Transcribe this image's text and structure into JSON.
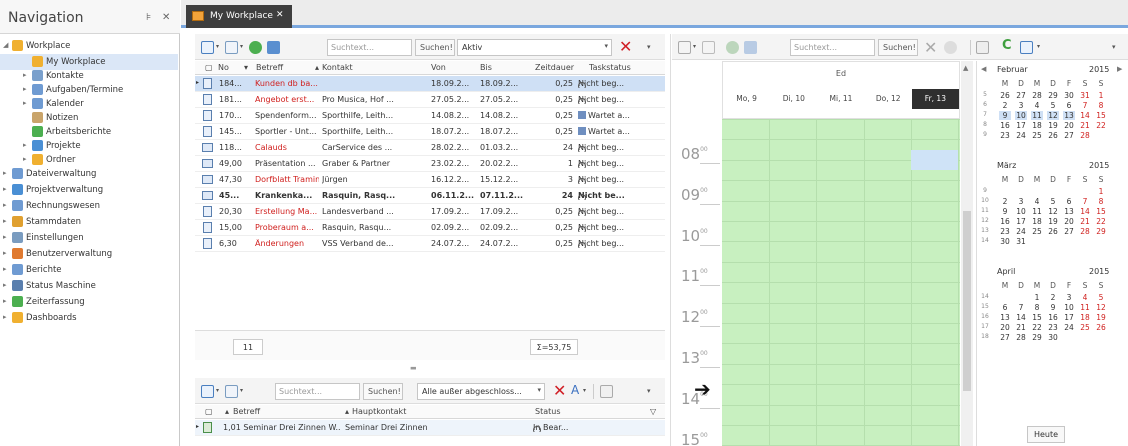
{
  "navigation": {
    "title": "Navigation",
    "pin_glyph": "⊧",
    "close_glyph": "✕",
    "items": [
      {
        "label": "Workplace",
        "level": 0,
        "expanded": true,
        "icon": "workplace-icon",
        "color": "#f0b030"
      },
      {
        "label": "My Workplace",
        "level": 1,
        "selected": true,
        "icon": "workplace-icon",
        "color": "#f0b030"
      },
      {
        "label": "Kontakte",
        "level": 1,
        "expanded": false,
        "icon": "contacts-icon",
        "color": "#7aa0cc"
      },
      {
        "label": "Aufgaben/Termine",
        "level": 1,
        "expanded": false,
        "icon": "tasks-icon",
        "color": "#6f9bd2"
      },
      {
        "label": "Kalender",
        "level": 1,
        "expanded": false,
        "icon": "calendar-icon",
        "color": "#6f9bd2"
      },
      {
        "label": "Notizen",
        "level": 1,
        "icon": "notes-icon",
        "color": "#c9a46a"
      },
      {
        "label": "Arbeitsberichte",
        "level": 1,
        "icon": "report-icon",
        "color": "#4caf50"
      },
      {
        "label": "Projekte",
        "level": 1,
        "expanded": false,
        "icon": "projects-icon",
        "color": "#4a8fd4"
      },
      {
        "label": "Ordner",
        "level": 1,
        "expanded": false,
        "icon": "folder-icon",
        "color": "#f0b030"
      },
      {
        "label": "Dateiverwaltung",
        "level": 0,
        "expanded": false,
        "icon": "files-icon",
        "color": "#6f9bd2"
      },
      {
        "label": "Projektverwaltung",
        "level": 0,
        "expanded": false,
        "icon": "projects-icon",
        "color": "#4a8fd4"
      },
      {
        "label": "Rechnungswesen",
        "level": 0,
        "expanded": false,
        "icon": "accounting-icon",
        "color": "#6f9bd2"
      },
      {
        "label": "Stammdaten",
        "level": 0,
        "expanded": false,
        "icon": "masterdata-icon",
        "color": "#e0a030"
      },
      {
        "label": "Einstellungen",
        "level": 0,
        "expanded": false,
        "icon": "settings-icon",
        "color": "#7a9cc0"
      },
      {
        "label": "Benutzerverwaltung",
        "level": 0,
        "expanded": false,
        "icon": "users-icon",
        "color": "#e07a30"
      },
      {
        "label": "Berichte",
        "level": 0,
        "expanded": false,
        "icon": "reports-icon",
        "color": "#6f9bd2"
      },
      {
        "label": "Status Maschine",
        "level": 0,
        "expanded": false,
        "icon": "status-machine-icon",
        "color": "#5a7fae"
      },
      {
        "label": "Zeiterfassung",
        "level": 0,
        "expanded": false,
        "icon": "time-icon",
        "color": "#4caf50"
      },
      {
        "label": "Dashboards",
        "level": 0,
        "expanded": false,
        "icon": "dashboard-icon",
        "color": "#f0b030"
      }
    ]
  },
  "tab": {
    "label": "My Workplace",
    "close_glyph": "✕"
  },
  "tasks_toolbar": {
    "search_placeholder": "Suchtext...",
    "search_button": "Suchen!",
    "filter_value": "Aktiv"
  },
  "tasks_grid": {
    "columns": [
      "No",
      "Betreff",
      "Kontakt",
      "Von",
      "Bis",
      "Zeitdauer",
      "Taskstatus"
    ],
    "rows": [
      {
        "no": "184...",
        "betreff": "Kunden db ba...",
        "kontakt": "",
        "von": "18.09.2...",
        "bis": "18.09.2...",
        "dauer": "0,25",
        "status": "Nicht beg...",
        "type": "doc",
        "red": true,
        "selected": true,
        "bold": false,
        "status_icon": "clock"
      },
      {
        "no": "181...",
        "betreff": "Angebot erst...",
        "kontakt": "Pro Musica, Hof ...",
        "von": "27.05.2...",
        "bis": "27.05.2...",
        "dauer": "0,25",
        "status": "Nicht beg...",
        "type": "doc",
        "red": true,
        "selected": false,
        "bold": false,
        "status_icon": "clock"
      },
      {
        "no": "170...",
        "betreff": "Spendenform...",
        "kontakt": "Sporthilfe, Leith...",
        "von": "14.08.2...",
        "bis": "14.08.2...",
        "dauer": "0,25",
        "status": "Wartet a...",
        "type": "doc",
        "red": false,
        "selected": false,
        "bold": false,
        "status_icon": "wait"
      },
      {
        "no": "145...",
        "betreff": "Sportler - Unt...",
        "kontakt": "Sporthilfe, Leith...",
        "von": "18.07.2...",
        "bis": "18.07.2...",
        "dauer": "0,25",
        "status": "Wartet a...",
        "type": "doc",
        "red": false,
        "selected": false,
        "bold": false,
        "status_icon": "wait"
      },
      {
        "no": "118...",
        "betreff": "Calauds",
        "kontakt": "CarService des ...",
        "von": "28.02.2...",
        "bis": "01.03.2...",
        "dauer": "24",
        "status": "Nicht beg...",
        "type": "mail",
        "red": true,
        "selected": false,
        "bold": false,
        "status_icon": "clock"
      },
      {
        "no": "49,00",
        "betreff": "Präsentation ...",
        "kontakt": "Graber & Partner",
        "von": "23.02.2...",
        "bis": "20.02.2...",
        "dauer": "1",
        "status": "Nicht beg...",
        "type": "mail",
        "red": false,
        "selected": false,
        "bold": false,
        "status_icon": "clock"
      },
      {
        "no": "47,30",
        "betreff": "Dorfblatt Tramin",
        "kontakt": "Jürgen",
        "von": "16.12.2...",
        "bis": "15.12.2...",
        "dauer": "3",
        "status": "Nicht beg...",
        "type": "mail",
        "red": true,
        "selected": false,
        "bold": false,
        "status_icon": "clock"
      },
      {
        "no": "45...",
        "betreff": "Krankenka...",
        "kontakt": "Rasquin, Rasq...",
        "von": "06.11.2...",
        "bis": "07.11.2...",
        "dauer": "24",
        "status": "Nicht be...",
        "type": "mail",
        "red": false,
        "selected": false,
        "bold": true,
        "status_icon": "clock"
      },
      {
        "no": "20,30",
        "betreff": "Erstellung Ma...",
        "kontakt": "Landesverband ...",
        "von": "17.09.2...",
        "bis": "17.09.2...",
        "dauer": "0,25",
        "status": "Nicht beg...",
        "type": "doc",
        "red": true,
        "selected": false,
        "bold": false,
        "status_icon": "clock"
      },
      {
        "no": "15,00",
        "betreff": "Proberaum a...",
        "kontakt": "Rasquin, Rasqu...",
        "von": "02.09.2...",
        "bis": "02.09.2...",
        "dauer": "0,25",
        "status": "Nicht beg...",
        "type": "doc",
        "red": true,
        "selected": false,
        "bold": false,
        "status_icon": "clock"
      },
      {
        "no": "6,30",
        "betreff": "Änderungen",
        "kontakt": "VSS Verband de...",
        "von": "24.07.2...",
        "bis": "24.07.2...",
        "dauer": "0,25",
        "status": "Nicht beg...",
        "type": "doc",
        "red": true,
        "selected": false,
        "bold": false,
        "status_icon": "clock"
      }
    ],
    "footer_count": "11",
    "footer_sum": "Σ=53,75"
  },
  "projects_toolbar": {
    "search_placeholder": "Suchtext...",
    "search_button": "Suchen!",
    "filter_value": "Alle außer abgeschloss..."
  },
  "projects_grid": {
    "columns": [
      "Betreff",
      "Hauptkontakt",
      "Status"
    ],
    "rows": [
      {
        "betreff": "1,01 Seminar Drei Zinnen W...",
        "kontakt": "Seminar Drei Zinnen",
        "status": "In Bear..."
      }
    ]
  },
  "calendar_toolbar": {
    "search_placeholder": "Suchtext...",
    "search_button": "Suchen!"
  },
  "calendar": {
    "week_label": "Ed",
    "days": [
      "Mo, 9",
      "Di, 10",
      "Mi, 11",
      "Do, 12",
      "Fr, 13"
    ],
    "hours": [
      "08",
      "09",
      "10",
      "11",
      "12",
      "13",
      "14",
      "15"
    ],
    "minute_suffix": "00",
    "now_arrow": "➔",
    "colors": {
      "slot": "#c8f0c0",
      "grid": "#b5dfad",
      "today": "#2f2f2f",
      "selected_slot": "#cfe3f7"
    }
  },
  "mini_calendars": [
    {
      "month": "Februar",
      "year": "2015",
      "weekdays": [
        "M",
        "D",
        "M",
        "D",
        "F",
        "S",
        "S"
      ],
      "weeks": [
        [
          "5",
          "26",
          "27",
          "28",
          "29",
          "30",
          "31",
          "1"
        ],
        [
          "6",
          "2",
          "3",
          "4",
          "5",
          "6",
          "7",
          "8"
        ],
        [
          "7",
          "9",
          "10",
          "11",
          "12",
          "13",
          "14",
          "15"
        ],
        [
          "8",
          "16",
          "17",
          "18",
          "19",
          "20",
          "21",
          "22"
        ],
        [
          "9",
          "23",
          "24",
          "25",
          "26",
          "27",
          "28",
          ""
        ]
      ]
    },
    {
      "month": "März",
      "year": "2015",
      "weekdays": [
        "M",
        "D",
        "M",
        "D",
        "F",
        "S",
        "S"
      ],
      "weeks": [
        [
          "9",
          "",
          "",
          "",
          "",
          "",
          "",
          "1"
        ],
        [
          "10",
          "2",
          "3",
          "4",
          "5",
          "6",
          "7",
          "8"
        ],
        [
          "11",
          "9",
          "10",
          "11",
          "12",
          "13",
          "14",
          "15"
        ],
        [
          "12",
          "16",
          "17",
          "18",
          "19",
          "20",
          "21",
          "22"
        ],
        [
          "13",
          "23",
          "24",
          "25",
          "26",
          "27",
          "28",
          "29"
        ],
        [
          "14",
          "30",
          "31",
          "",
          "",
          "",
          "",
          ""
        ]
      ]
    },
    {
      "month": "April",
      "year": "2015",
      "weekdays": [
        "M",
        "D",
        "M",
        "D",
        "F",
        "S",
        "S"
      ],
      "weeks": [
        [
          "14",
          "",
          "",
          "1",
          "2",
          "3",
          "4",
          "5"
        ],
        [
          "15",
          "6",
          "7",
          "8",
          "9",
          "10",
          "11",
          "12"
        ],
        [
          "16",
          "13",
          "14",
          "15",
          "16",
          "17",
          "18",
          "19"
        ],
        [
          "17",
          "20",
          "21",
          "22",
          "23",
          "24",
          "25",
          "26"
        ],
        [
          "18",
          "27",
          "28",
          "29",
          "30",
          "",
          "",
          ""
        ]
      ]
    }
  ],
  "mini_calendar_nav": {
    "prev": "◀",
    "next": "▶"
  },
  "today_button": "Heute"
}
